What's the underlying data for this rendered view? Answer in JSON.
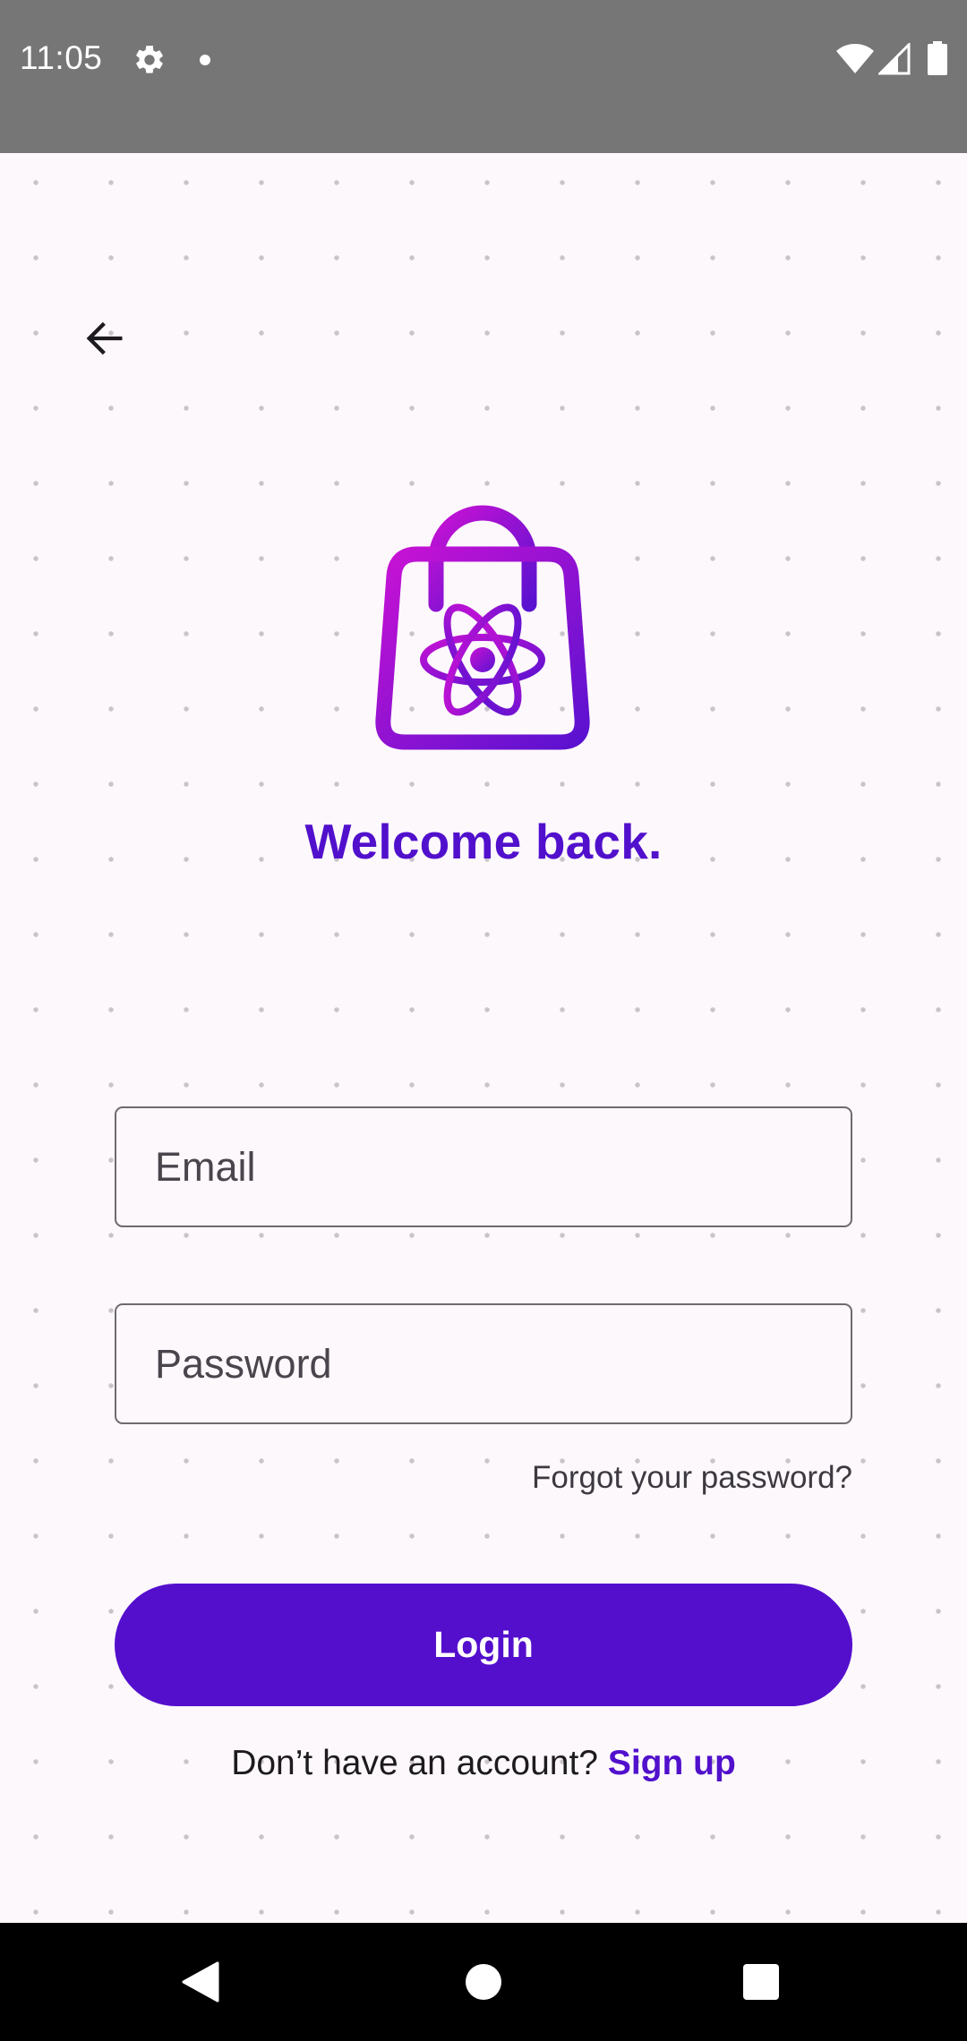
{
  "status_bar": {
    "time": "11:05",
    "icons": [
      "gear-icon",
      "notification-dot-icon",
      "wifi-icon",
      "signal-icon",
      "battery-icon"
    ]
  },
  "header": {
    "back_icon": "arrow-back-icon"
  },
  "logo": {
    "icon": "shopping-bag-react-icon",
    "gradient": [
      "#c812d4",
      "#5a12d0"
    ]
  },
  "login": {
    "title": "Welcome back.",
    "email_placeholder": "Email",
    "password_placeholder": "Password",
    "forgot_label": "Forgot your password?",
    "login_label": "Login",
    "signup_prompt": "Don’t have an account?",
    "signup_label": "Sign up"
  },
  "colors": {
    "accent": "#540fcd",
    "background": "#fdf8fc",
    "status_bar": "#767676",
    "nav_bar": "#000000"
  },
  "nav_bar": {
    "icons": [
      "nav-back-icon",
      "nav-home-icon",
      "nav-recents-icon"
    ]
  }
}
